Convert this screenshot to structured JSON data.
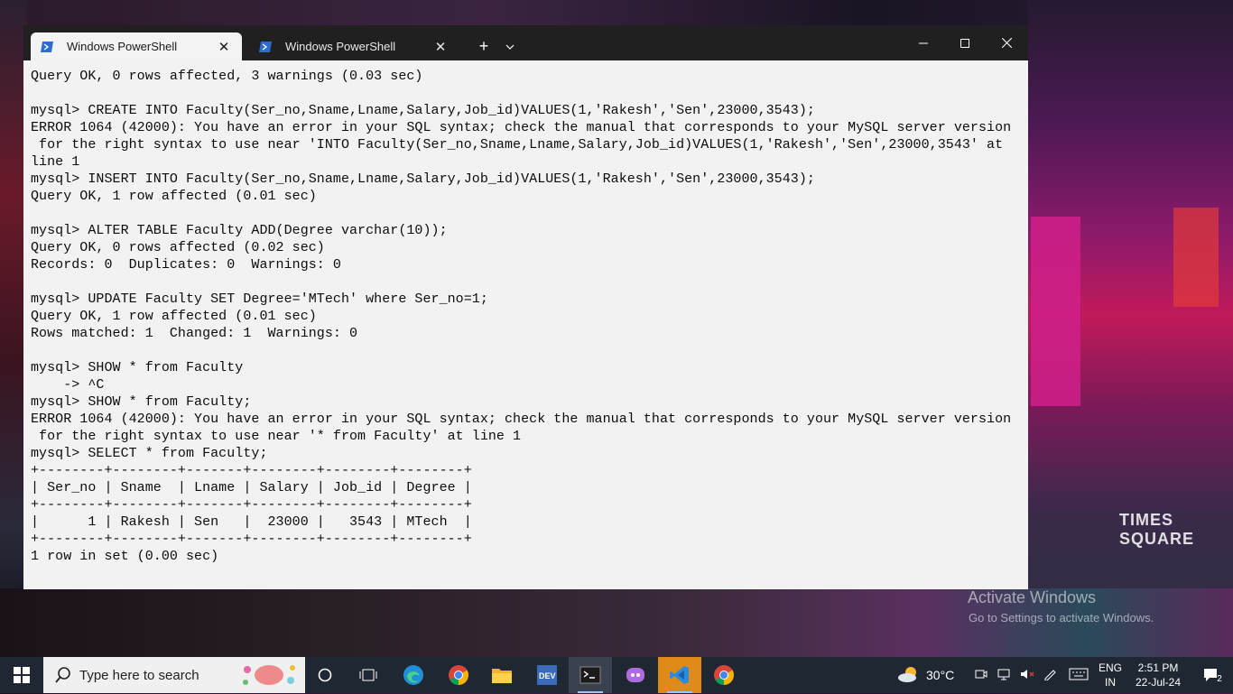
{
  "wallpaper": {
    "sign_text": "TIMES SQUARE",
    "activation_title": "Activate Windows",
    "activation_subtitle": "Go to Settings to activate Windows."
  },
  "window": {
    "tabs": [
      {
        "label": "Windows PowerShell",
        "icon": "powershell-icon",
        "active": true
      },
      {
        "label": "Windows PowerShell",
        "icon": "powershell-icon",
        "active": false
      }
    ],
    "buttons": {
      "new_tab": "+",
      "dropdown": "chevron-down-icon",
      "minimize": "minimize-icon",
      "maximize": "maximize-icon",
      "close": "close-icon"
    },
    "accent_color": "#f3f3f3"
  },
  "terminal": {
    "background": "#f2f2f2",
    "foreground": "#0c0c0c",
    "lines": [
      "Query OK, 0 rows affected, 3 warnings (0.03 sec)",
      "",
      "mysql> CREATE INTO Faculty(Ser_no,Sname,Lname,Salary,Job_id)VALUES(1,'Rakesh','Sen',23000,3543);",
      "ERROR 1064 (42000): You have an error in your SQL syntax; check the manual that corresponds to your MySQL server version",
      " for the right syntax to use near 'INTO Faculty(Ser_no,Sname,Lname,Salary,Job_id)VALUES(1,'Rakesh','Sen',23000,3543' at",
      "line 1",
      "mysql> INSERT INTO Faculty(Ser_no,Sname,Lname,Salary,Job_id)VALUES(1,'Rakesh','Sen',23000,3543);",
      "Query OK, 1 row affected (0.01 sec)",
      "",
      "mysql> ALTER TABLE Faculty ADD(Degree varchar(10));",
      "Query OK, 0 rows affected (0.02 sec)",
      "Records: 0  Duplicates: 0  Warnings: 0",
      "",
      "mysql> UPDATE Faculty SET Degree='MTech' where Ser_no=1;",
      "Query OK, 1 row affected (0.01 sec)",
      "Rows matched: 1  Changed: 1  Warnings: 0",
      "",
      "mysql> SHOW * from Faculty",
      "    -> ^C",
      "mysql> SHOW * from Faculty;",
      "ERROR 1064 (42000): You have an error in your SQL syntax; check the manual that corresponds to your MySQL server version",
      " for the right syntax to use near '* from Faculty' at line 1",
      "mysql> SELECT * from Faculty;",
      "+--------+--------+-------+--------+--------+--------+",
      "| Ser_no | Sname  | Lname | Salary | Job_id | Degree |",
      "+--------+--------+-------+--------+--------+--------+",
      "|      1 | Rakesh | Sen   |  23000 |   3543 | MTech  |",
      "+--------+--------+-------+--------+--------+--------+",
      "1 row in set (0.00 sec)"
    ]
  },
  "taskbar": {
    "search_placeholder": "Type here to search",
    "apps": [
      "cortana-icon",
      "task-view-icon",
      "edge-icon",
      "chrome-icon",
      "file-explorer-icon",
      "dev-icon",
      "terminal-icon",
      "chat-app-icon",
      "vscode-icon",
      "chrome-icon"
    ],
    "weather": "30°C",
    "language_top": "ENG",
    "language_bottom": "IN",
    "time": "2:51 PM",
    "date": "22-Jul-24",
    "notification_count": "2"
  }
}
